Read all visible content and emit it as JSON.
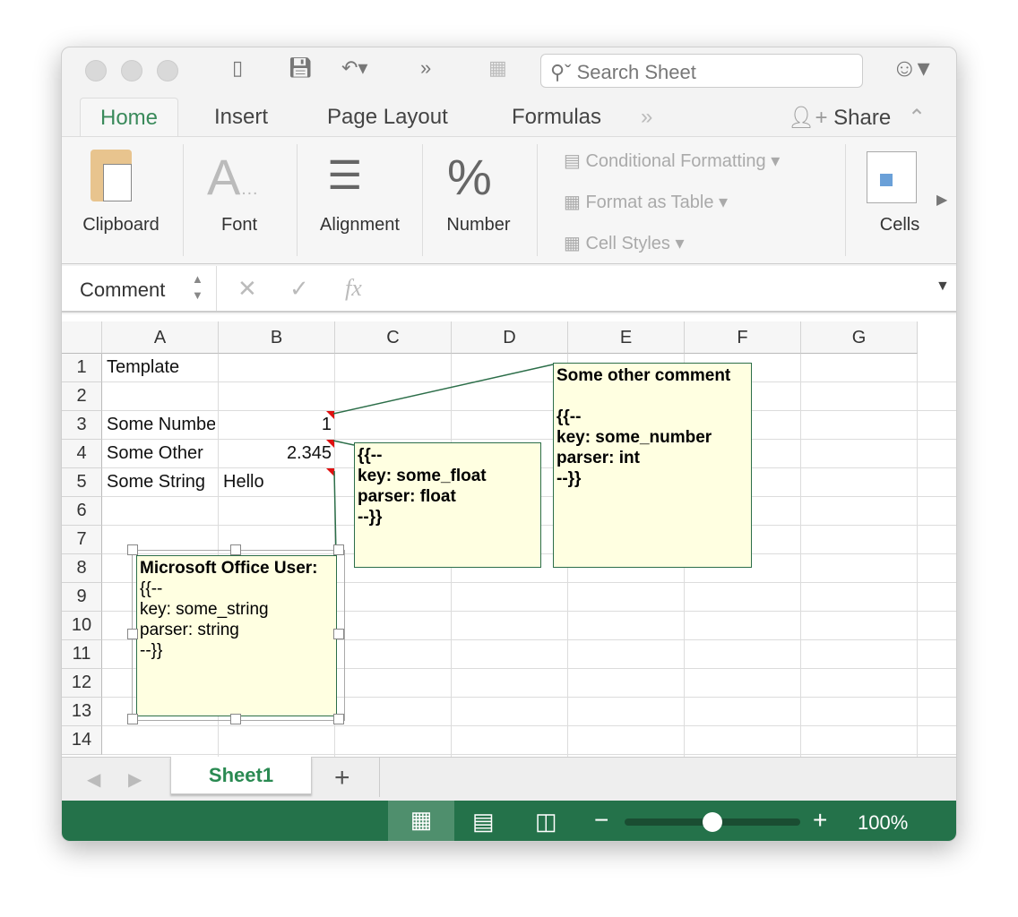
{
  "titlebar": {
    "search_placeholder": "Search Sheet",
    "icons": [
      "sidebar-icon",
      "save-icon",
      "undo-icon",
      "more-icon",
      "excel-file-icon",
      "search-icon",
      "smiley-feedback-icon"
    ]
  },
  "tabs": [
    {
      "label": "Home",
      "active": true
    },
    {
      "label": "Insert"
    },
    {
      "label": "Page Layout"
    },
    {
      "label": "Formulas"
    }
  ],
  "share_label": "Share",
  "ribbon": {
    "groups": [
      "Clipboard",
      "Font",
      "Alignment",
      "Number",
      "Cells"
    ],
    "styles": [
      "Conditional Formatting",
      "Format as Table",
      "Cell Styles"
    ]
  },
  "formula_bar": {
    "name_box": "Comment",
    "fx": "fx",
    "value": ""
  },
  "columns": [
    "A",
    "B",
    "C",
    "D",
    "E",
    "F",
    "G"
  ],
  "rows": [
    "1",
    "2",
    "3",
    "4",
    "5",
    "6",
    "7",
    "8",
    "9",
    "10",
    "11",
    "12",
    "13",
    "14"
  ],
  "cells": {
    "A1": "Template",
    "A3": "Some Number",
    "A4": "Some Other",
    "A5": "Some String",
    "B3": "1",
    "B4": "2.345",
    "B5": "Hello"
  },
  "comments": [
    {
      "cell": "B3",
      "text": "Some other comment\n\n{{--\nkey: some_number\nparser: int\n--}}"
    },
    {
      "cell": "B4",
      "text": "{{--\nkey: some_float\nparser: float\n--}}"
    },
    {
      "cell": "B5",
      "author": "Microsoft Office User:",
      "text": "{{--\nkey: some_string\nparser: string\n--}}"
    }
  ],
  "sheet_tabs": [
    {
      "label": "Sheet1",
      "active": true
    }
  ],
  "add_sheet": "+",
  "status": {
    "zoom": "100%",
    "zoom_fraction": 0.5,
    "accent": "#24724a"
  }
}
